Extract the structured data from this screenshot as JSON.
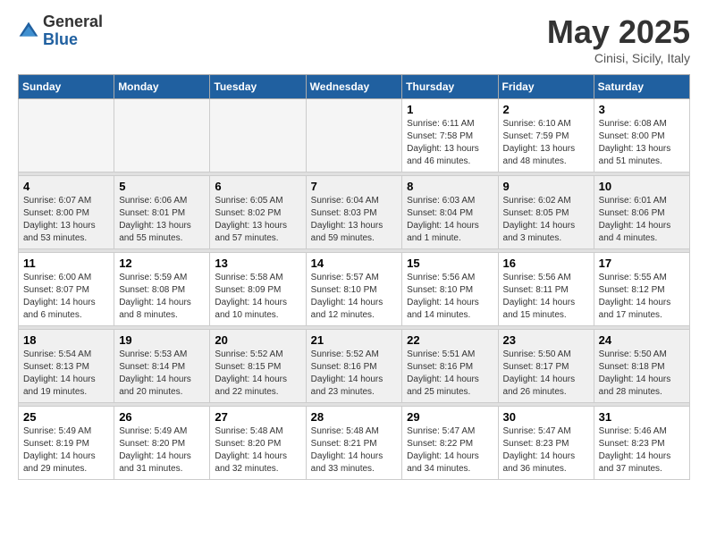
{
  "header": {
    "logo_general": "General",
    "logo_blue": "Blue",
    "month": "May 2025",
    "location": "Cinisi, Sicily, Italy"
  },
  "days_of_week": [
    "Sunday",
    "Monday",
    "Tuesday",
    "Wednesday",
    "Thursday",
    "Friday",
    "Saturday"
  ],
  "weeks": [
    [
      {
        "day": "",
        "empty": true
      },
      {
        "day": "",
        "empty": true
      },
      {
        "day": "",
        "empty": true
      },
      {
        "day": "",
        "empty": true
      },
      {
        "day": "1",
        "sunrise": "6:11 AM",
        "sunset": "7:58 PM",
        "daylight": "13 hours and 46 minutes."
      },
      {
        "day": "2",
        "sunrise": "6:10 AM",
        "sunset": "7:59 PM",
        "daylight": "13 hours and 48 minutes."
      },
      {
        "day": "3",
        "sunrise": "6:08 AM",
        "sunset": "8:00 PM",
        "daylight": "13 hours and 51 minutes."
      }
    ],
    [
      {
        "day": "4",
        "sunrise": "6:07 AM",
        "sunset": "8:00 PM",
        "daylight": "13 hours and 53 minutes."
      },
      {
        "day": "5",
        "sunrise": "6:06 AM",
        "sunset": "8:01 PM",
        "daylight": "13 hours and 55 minutes."
      },
      {
        "day": "6",
        "sunrise": "6:05 AM",
        "sunset": "8:02 PM",
        "daylight": "13 hours and 57 minutes."
      },
      {
        "day": "7",
        "sunrise": "6:04 AM",
        "sunset": "8:03 PM",
        "daylight": "13 hours and 59 minutes."
      },
      {
        "day": "8",
        "sunrise": "6:03 AM",
        "sunset": "8:04 PM",
        "daylight": "14 hours and 1 minute."
      },
      {
        "day": "9",
        "sunrise": "6:02 AM",
        "sunset": "8:05 PM",
        "daylight": "14 hours and 3 minutes."
      },
      {
        "day": "10",
        "sunrise": "6:01 AM",
        "sunset": "8:06 PM",
        "daylight": "14 hours and 4 minutes."
      }
    ],
    [
      {
        "day": "11",
        "sunrise": "6:00 AM",
        "sunset": "8:07 PM",
        "daylight": "14 hours and 6 minutes."
      },
      {
        "day": "12",
        "sunrise": "5:59 AM",
        "sunset": "8:08 PM",
        "daylight": "14 hours and 8 minutes."
      },
      {
        "day": "13",
        "sunrise": "5:58 AM",
        "sunset": "8:09 PM",
        "daylight": "14 hours and 10 minutes."
      },
      {
        "day": "14",
        "sunrise": "5:57 AM",
        "sunset": "8:10 PM",
        "daylight": "14 hours and 12 minutes."
      },
      {
        "day": "15",
        "sunrise": "5:56 AM",
        "sunset": "8:10 PM",
        "daylight": "14 hours and 14 minutes."
      },
      {
        "day": "16",
        "sunrise": "5:56 AM",
        "sunset": "8:11 PM",
        "daylight": "14 hours and 15 minutes."
      },
      {
        "day": "17",
        "sunrise": "5:55 AM",
        "sunset": "8:12 PM",
        "daylight": "14 hours and 17 minutes."
      }
    ],
    [
      {
        "day": "18",
        "sunrise": "5:54 AM",
        "sunset": "8:13 PM",
        "daylight": "14 hours and 19 minutes."
      },
      {
        "day": "19",
        "sunrise": "5:53 AM",
        "sunset": "8:14 PM",
        "daylight": "14 hours and 20 minutes."
      },
      {
        "day": "20",
        "sunrise": "5:52 AM",
        "sunset": "8:15 PM",
        "daylight": "14 hours and 22 minutes."
      },
      {
        "day": "21",
        "sunrise": "5:52 AM",
        "sunset": "8:16 PM",
        "daylight": "14 hours and 23 minutes."
      },
      {
        "day": "22",
        "sunrise": "5:51 AM",
        "sunset": "8:16 PM",
        "daylight": "14 hours and 25 minutes."
      },
      {
        "day": "23",
        "sunrise": "5:50 AM",
        "sunset": "8:17 PM",
        "daylight": "14 hours and 26 minutes."
      },
      {
        "day": "24",
        "sunrise": "5:50 AM",
        "sunset": "8:18 PM",
        "daylight": "14 hours and 28 minutes."
      }
    ],
    [
      {
        "day": "25",
        "sunrise": "5:49 AM",
        "sunset": "8:19 PM",
        "daylight": "14 hours and 29 minutes."
      },
      {
        "day": "26",
        "sunrise": "5:49 AM",
        "sunset": "8:20 PM",
        "daylight": "14 hours and 31 minutes."
      },
      {
        "day": "27",
        "sunrise": "5:48 AM",
        "sunset": "8:20 PM",
        "daylight": "14 hours and 32 minutes."
      },
      {
        "day": "28",
        "sunrise": "5:48 AM",
        "sunset": "8:21 PM",
        "daylight": "14 hours and 33 minutes."
      },
      {
        "day": "29",
        "sunrise": "5:47 AM",
        "sunset": "8:22 PM",
        "daylight": "14 hours and 34 minutes."
      },
      {
        "day": "30",
        "sunrise": "5:47 AM",
        "sunset": "8:23 PM",
        "daylight": "14 hours and 36 minutes."
      },
      {
        "day": "31",
        "sunrise": "5:46 AM",
        "sunset": "8:23 PM",
        "daylight": "14 hours and 37 minutes."
      }
    ]
  ]
}
